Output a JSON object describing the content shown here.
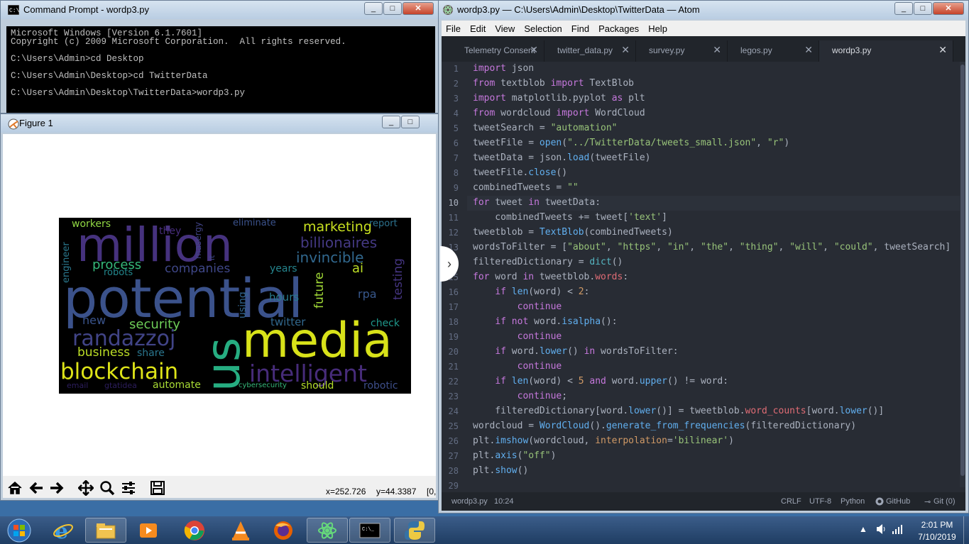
{
  "cmd": {
    "title": "Command Prompt - wordp3.py",
    "lines": [
      "Microsoft Windows [Version 6.1.7601]",
      "Copyright (c) 2009 Microsoft Corporation.  All rights reserved.",
      "",
      "C:\\Users\\Admin>cd Desktop",
      "",
      "C:\\Users\\Admin\\Desktop>cd TwitterData",
      "",
      "C:\\Users\\Admin\\Desktop\\TwitterData>wordp3.py"
    ]
  },
  "figure": {
    "title": "Figure 1",
    "x_readout": "x=252.726",
    "y_readout": "y=44.3387",
    "pixel_readout": "[0,",
    "words": [
      {
        "text": "workers",
        "color": "#90d743"
      },
      {
        "text": "eliminate",
        "color": "#3b528b"
      },
      {
        "text": "report",
        "color": "#2c728e"
      },
      {
        "text": "million",
        "color": "#46327e"
      },
      {
        "text": "they",
        "color": "#472d7b"
      },
      {
        "text": "masergy",
        "color": "#414487"
      },
      {
        "text": "marketing",
        "color": "#c8e020"
      },
      {
        "text": "billionaires",
        "color": "#443983"
      },
      {
        "text": "engineer",
        "color": "#2a788e"
      },
      {
        "text": "it",
        "color": "#3e4989"
      },
      {
        "text": "invincible",
        "color": "#31688e"
      },
      {
        "text": "process",
        "color": "#35b779"
      },
      {
        "text": "robots",
        "color": "#23888e"
      },
      {
        "text": "companies",
        "color": "#3f4788"
      },
      {
        "text": "years",
        "color": "#25858e"
      },
      {
        "text": "ai",
        "color": "#bddf26"
      },
      {
        "text": "potential",
        "color": "#3b528b"
      },
      {
        "text": "testing",
        "color": "#453581"
      },
      {
        "text": "hours",
        "color": "#297b8e"
      },
      {
        "text": "future",
        "color": "#a2da37"
      },
      {
        "text": "rpa",
        "color": "#38588c"
      },
      {
        "text": "using",
        "color": "#32658e"
      },
      {
        "text": "new",
        "color": "#3a548c"
      },
      {
        "text": "security",
        "color": "#6ece58"
      },
      {
        "text": "twitter",
        "color": "#31688e"
      },
      {
        "text": "check",
        "color": "#1f988b"
      },
      {
        "text": "randazzoj",
        "color": "#414487"
      },
      {
        "text": "us",
        "color": "#26ad81"
      },
      {
        "text": "media",
        "color": "#d8e219"
      },
      {
        "text": "business",
        "color": "#bddf26"
      },
      {
        "text": "share",
        "color": "#2a768e"
      },
      {
        "text": "intelligent",
        "color": "#472c7a"
      },
      {
        "text": "blockchain",
        "color": "#dde318"
      },
      {
        "text": "email",
        "color": "#2d1e5e"
      },
      {
        "text": "gtatidea",
        "color": "#2d1e5e"
      },
      {
        "text": "automate",
        "color": "#a8db34"
      },
      {
        "text": "cybersecurity",
        "color": "#35b779"
      },
      {
        "text": "should",
        "color": "#b5de2b"
      },
      {
        "text": "robotic",
        "color": "#3d4e8a"
      }
    ]
  },
  "atom": {
    "title": "wordp3.py — C:\\Users\\Admin\\Desktop\\TwitterData — Atom",
    "menu": [
      "File",
      "Edit",
      "View",
      "Selection",
      "Find",
      "Packages",
      "Help"
    ],
    "tabs": [
      "Telemetry Consent",
      "twitter_data.py",
      "survey.py",
      "legos.py",
      "wordp3.py"
    ],
    "active_tab": 4,
    "line_numbers": [
      "1",
      "2",
      "3",
      "4",
      "5",
      "6",
      "7",
      "8",
      "9",
      "10",
      "11",
      "12",
      "13",
      "14",
      "15",
      "16",
      "17",
      "18",
      "19",
      "20",
      "21",
      "22",
      "23",
      "24",
      "25",
      "26",
      "27",
      "28",
      "29"
    ],
    "current_line": 10,
    "status": {
      "file": "wordp3.py",
      "cursor": "10:24",
      "line_ending": "CRLF",
      "encoding": "UTF-8",
      "grammar": "Python",
      "github": "GitHub",
      "git": "Git (0)"
    }
  },
  "taskbar": {
    "time": "2:01 PM",
    "date": "7/10/2019",
    "apps": [
      "start-orb",
      "internet-explorer",
      "file-explorer",
      "media-player",
      "chrome",
      "vlc",
      "firefox",
      "atom",
      "command-prompt",
      "python"
    ]
  },
  "colors": {
    "editor_bg": "#282c34",
    "keyword": "#c678dd",
    "string": "#98c379",
    "function": "#61afef",
    "number": "#d19a66",
    "attribute": "#e06c75"
  }
}
